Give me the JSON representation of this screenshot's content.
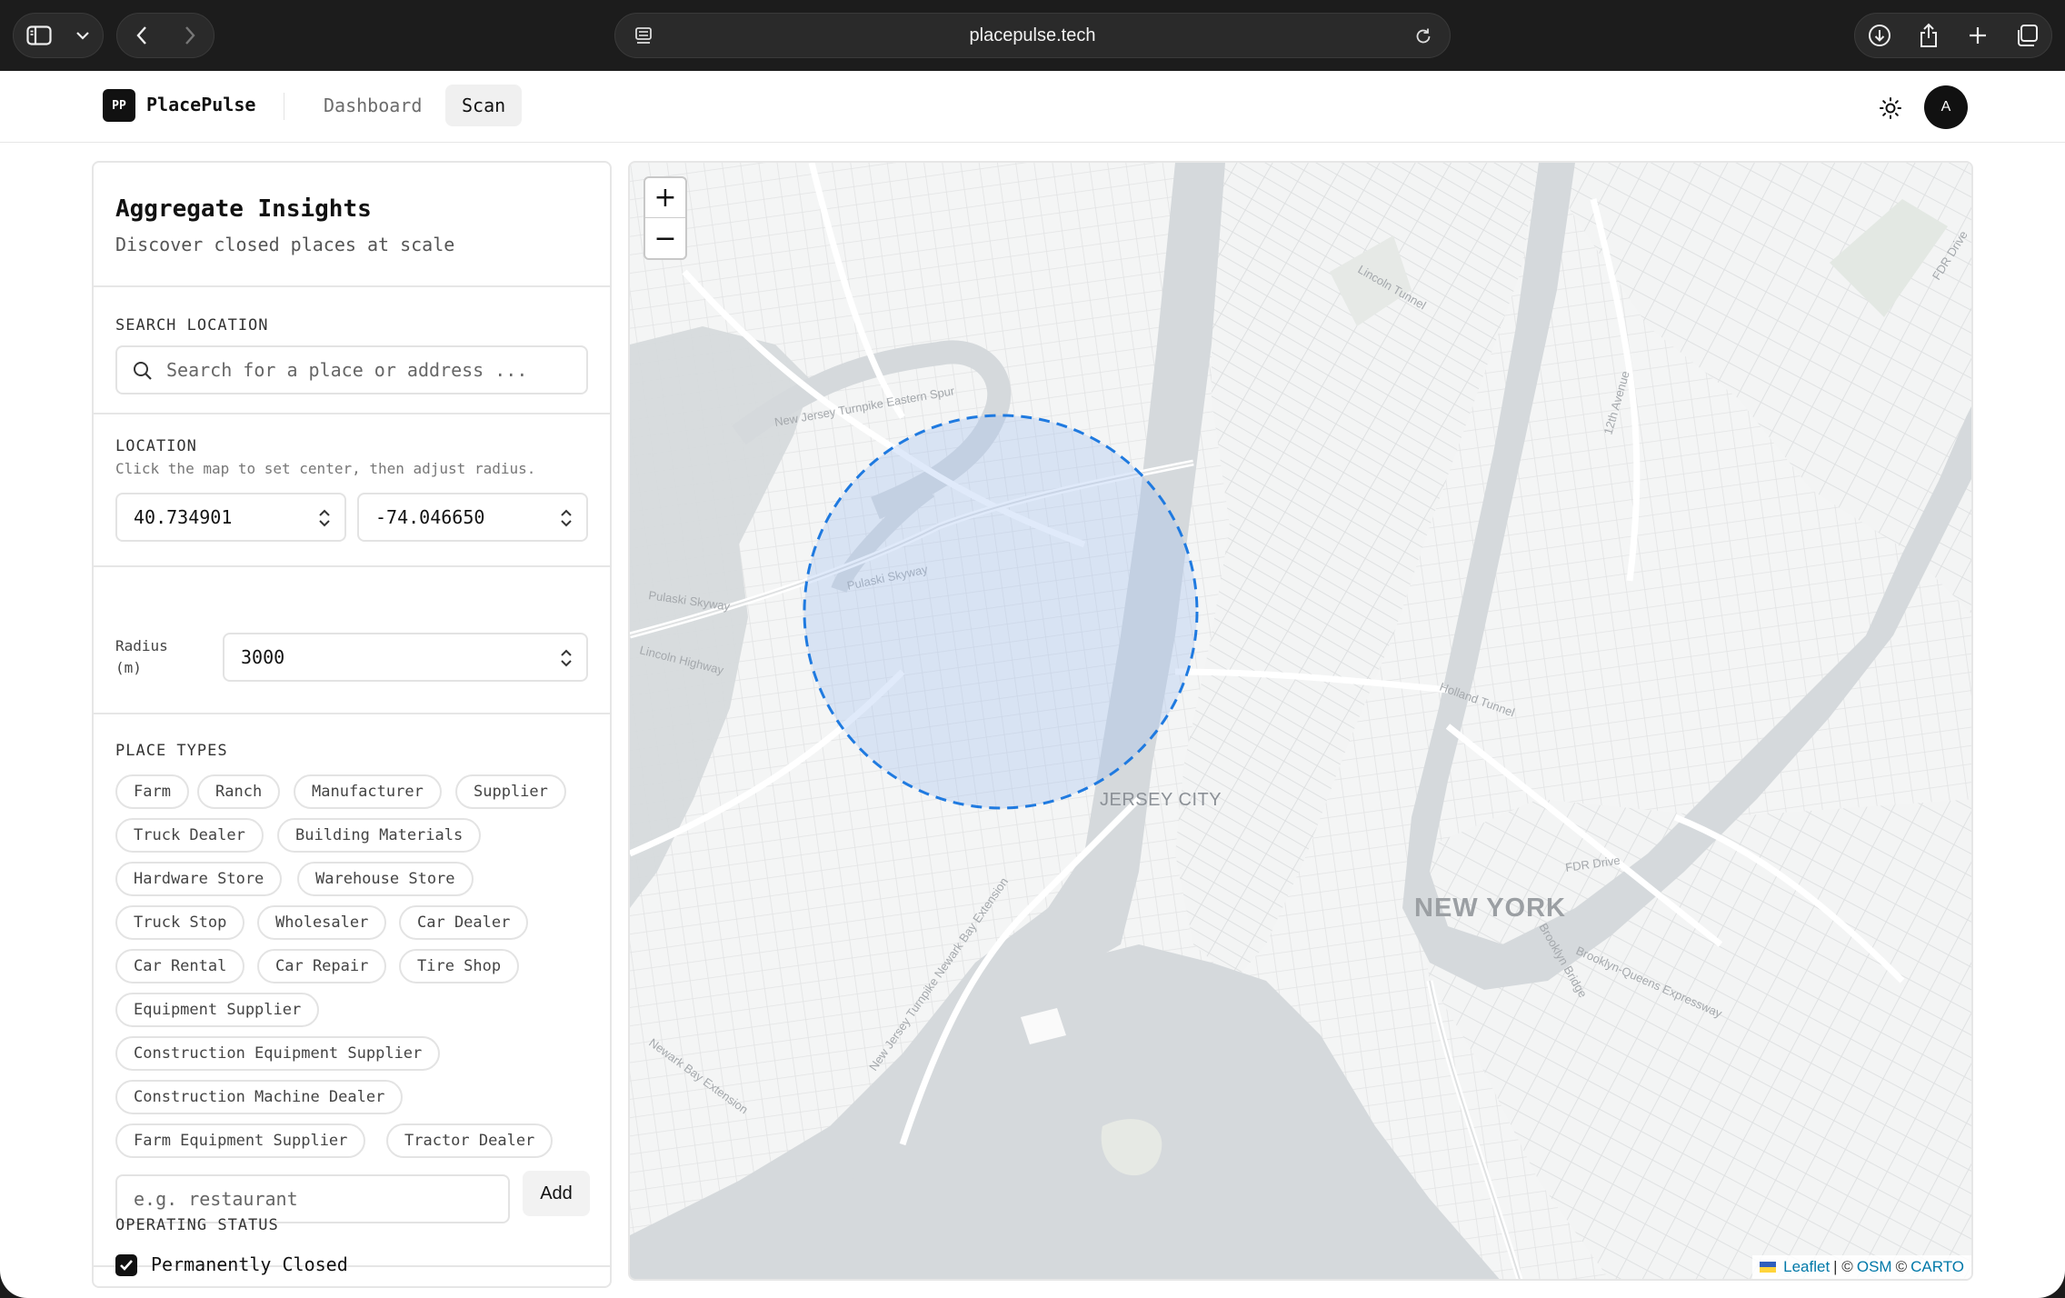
{
  "browser": {
    "url": "placepulse.tech"
  },
  "app": {
    "logo_text": "PP",
    "brand": "PlacePulse",
    "nav": [
      {
        "label": "Dashboard"
      },
      {
        "label": "Scan"
      }
    ],
    "avatar": "A"
  },
  "sidebar": {
    "title": "Aggregate Insights",
    "subtitle": "Discover closed places at scale",
    "search": {
      "label": "SEARCH LOCATION",
      "placeholder": "Search for a place or address ..."
    },
    "location": {
      "label": "LOCATION",
      "hint": "Click the map to set center, then adjust radius.",
      "latitude": "40.734901",
      "longitude": "-74.046650",
      "radius_label": "Radius (m)",
      "radius": "3000"
    },
    "place_types": {
      "label": "PLACE TYPES",
      "chips": [
        "Farm",
        "Ranch",
        "Manufacturer",
        "Supplier",
        "Truck Dealer",
        "Building Materials",
        "Hardware Store",
        "Warehouse Store",
        "Truck Stop",
        "Wholesaler",
        "Car Dealer",
        "Car Rental",
        "Car Repair",
        "Tire Shop",
        "Equipment Supplier",
        "Construction Equipment Supplier",
        "Construction Machine Dealer",
        "Farm Equipment Supplier",
        "Tractor Dealer"
      ],
      "add_placeholder": "e.g. restaurant",
      "add_label": "Add"
    },
    "operating_status": {
      "label": "OPERATING STATUS",
      "option": "Permanently Closed",
      "checked": true
    }
  },
  "map": {
    "zoom_in": "+",
    "zoom_out": "−",
    "labels": {
      "jersey_city": "JERSEY CITY",
      "new_york": "NEW YORK"
    },
    "attribution": {
      "leaflet": "Leaflet",
      "sep1": "| ©",
      "osm": "OSM",
      "sep2": "©",
      "carto": "CARTO"
    },
    "radius_circle_color": "#1f7ae0"
  }
}
